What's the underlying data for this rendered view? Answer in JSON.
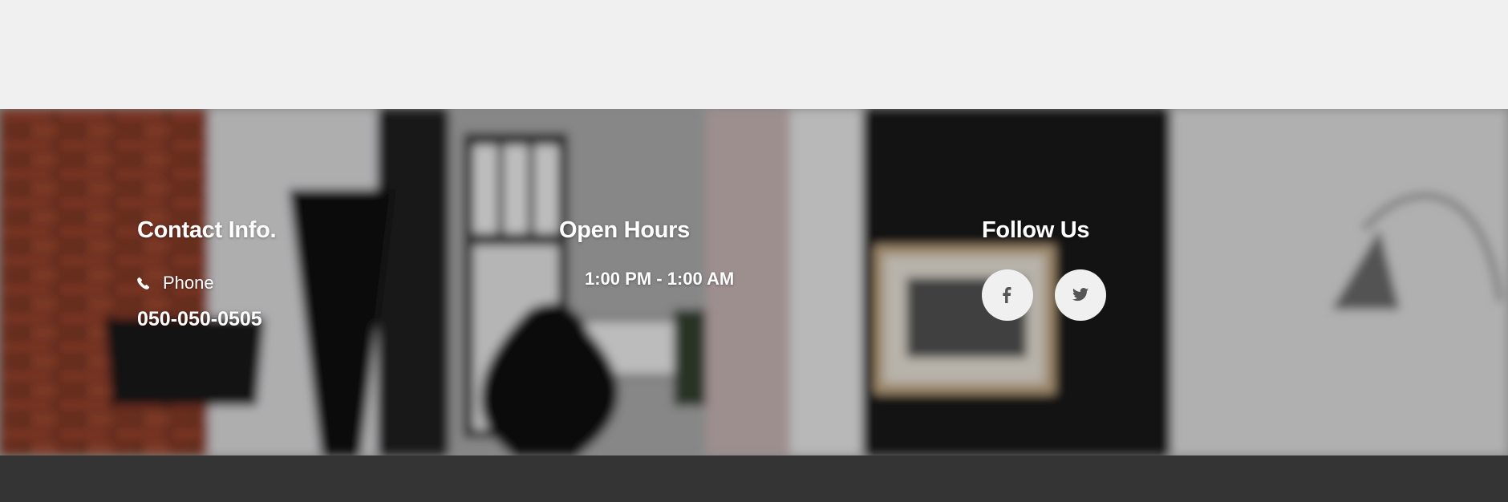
{
  "footer": {
    "contact": {
      "heading": "Contact Info.",
      "phone_icon": "phone-icon",
      "phone_label": "Phone",
      "phone_number": "050-050-0505"
    },
    "hours": {
      "heading": "Open Hours",
      "line": "1:00 PM - 1:00 AM"
    },
    "follow": {
      "heading": "Follow Us",
      "links": [
        {
          "icon": "facebook-icon"
        },
        {
          "icon": "twitter-icon"
        }
      ]
    }
  },
  "colors": {
    "top_band": "#f0f0f0",
    "bottom_bar": "#343434",
    "heading_text": "#ffffff",
    "social_button_bg": "#f0f0f0",
    "social_icon": "#555555"
  }
}
